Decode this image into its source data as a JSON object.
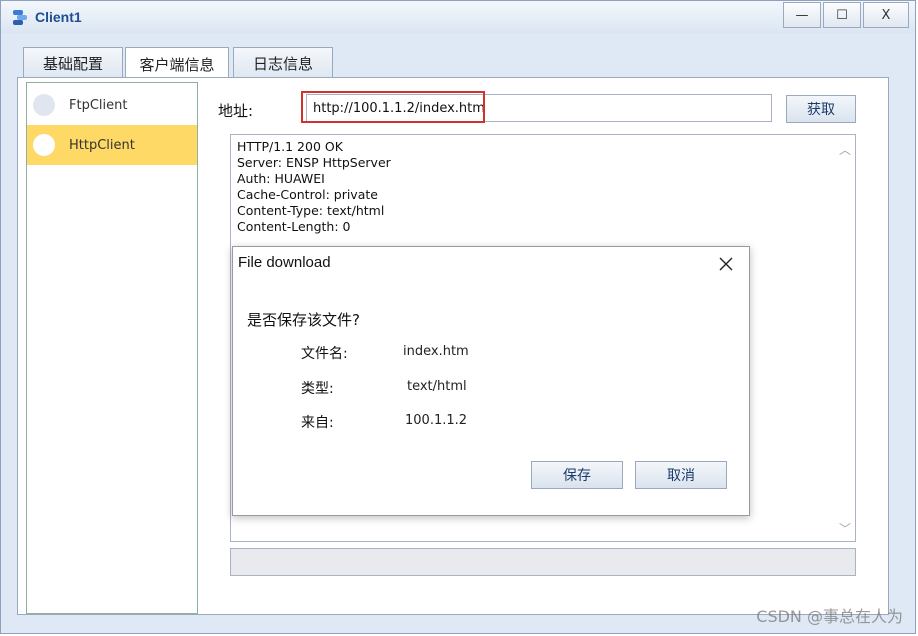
{
  "window": {
    "title": "Client1",
    "minimize_glyph": "—",
    "maximize_glyph": "☐",
    "close_glyph": "X"
  },
  "tabs": [
    {
      "label": "基础配置"
    },
    {
      "label": "客户端信息",
      "active": true
    },
    {
      "label": "日志信息"
    }
  ],
  "clients": [
    {
      "label": "FtpClient"
    },
    {
      "label": "HttpClient",
      "selected": true
    }
  ],
  "address": {
    "label": "地址:",
    "value": "http://100.1.1.2/index.htm",
    "fetch_label": "获取"
  },
  "response": {
    "text": "HTTP/1.1 200 OK\nServer: ENSP HttpServer\nAuth: HUAWEI\nCache-Control: private\nContent-Type: text/html\nContent-Length: 0"
  },
  "progress": {
    "fraction": 0
  },
  "dialog": {
    "title": "File download",
    "question": "是否保存该文件?",
    "rows": [
      {
        "label": "文件名:",
        "value": "index.htm"
      },
      {
        "label": "类型:",
        "value": "text/html"
      },
      {
        "label": "来自:",
        "value": "100.1.1.2"
      }
    ],
    "save_label": "保存",
    "cancel_label": "取消"
  },
  "watermark": "CSDN @事总在人为",
  "colors": {
    "selected_item": "#ffd966",
    "highlight_border": "#d2322d",
    "title_text": "#1d4f91"
  }
}
